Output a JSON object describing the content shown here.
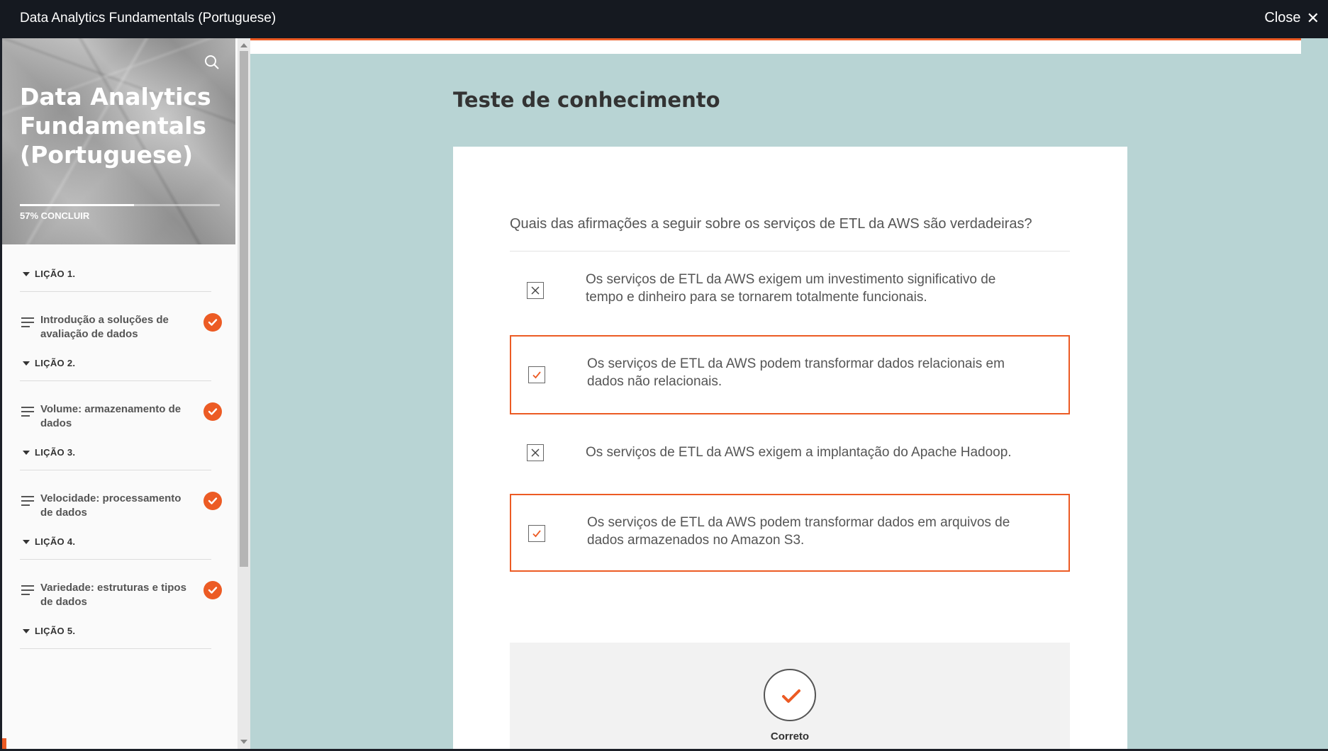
{
  "window": {
    "title": "Data Analytics Fundamentals (Portuguese)",
    "close_label": "Close"
  },
  "sidebar": {
    "course_title": "Data Analytics Fundamentals (Portuguese)",
    "progress_fraction": 0.57,
    "progress_label": "57% CONCLUIR",
    "lessons": [
      {
        "header": "LIÇÃO 1.",
        "item": "Introdução a soluções de avaliação de dados",
        "completed": true
      },
      {
        "header": "LIÇÃO 2.",
        "item": "Volume: armazenamento de dados",
        "completed": true
      },
      {
        "header": "LIÇÃO 3.",
        "item": "Velocidade: processamento de dados",
        "completed": true
      },
      {
        "header": "LIÇÃO 4.",
        "item": "Variedade: estruturas e tipos de dados",
        "completed": true
      },
      {
        "header": "LIÇÃO 5."
      }
    ]
  },
  "main": {
    "heading": "Teste de conhecimento",
    "question": "Quais das afirmações a seguir sobre os serviços de ETL da AWS são verdadeiras?",
    "options": [
      {
        "text": "Os serviços de ETL da AWS exigem um investimento significativo de tempo e dinheiro para se tornarem totalmente funcionais.",
        "selected": false,
        "mark": "x"
      },
      {
        "text": "Os serviços de ETL da AWS podem transformar dados relacionais em dados não relacionais.",
        "selected": true,
        "mark": "check"
      },
      {
        "text": "Os serviços de ETL da AWS exigem a implantação do Apache Hadoop.",
        "selected": false,
        "mark": "x"
      },
      {
        "text": "Os serviços de ETL da AWS podem transformar dados em arquivos de dados armazenados no Amazon S3.",
        "selected": true,
        "mark": "check"
      }
    ],
    "feedback_label": "Correto"
  },
  "colors": {
    "accent": "#ec5b24",
    "background_main": "#b8d4d4",
    "topbar": "#151920"
  },
  "icons": [
    "search-icon",
    "close-icon",
    "checkmark-icon",
    "x-mark-icon",
    "lesson-lines-icon",
    "caret-down-icon"
  ]
}
